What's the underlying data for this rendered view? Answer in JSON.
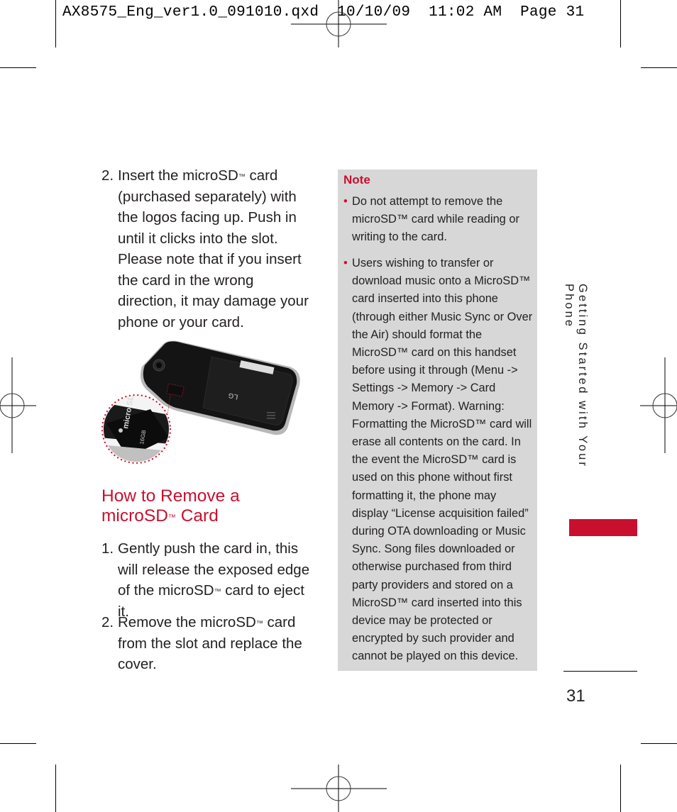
{
  "slug_line": "AX8575_Eng_ver1.0_091010.qxd  10/10/09  11:02 AM  Page 31",
  "insert_step": {
    "number": "2.",
    "text_before_tm": "Insert the microSD",
    "tm": "™",
    "text_after_tm": " card (purchased separately) with the logos facing up. Push in until it clicks into the slot. Please note that if you insert the card in the wrong direction, it may damage your phone or your card."
  },
  "figure": {
    "description": "Back of phone with microSD card inserted, magnified inset of card slot",
    "card_label": "micro SD",
    "card_capacity": "16GB",
    "brand": "LG",
    "inset_color": "#c8102e"
  },
  "section": {
    "heading_line1": "How to Remove a",
    "heading_line2_before_tm": "microSD",
    "heading_tm": "™",
    "heading_line2_after_tm": " Card"
  },
  "remove_steps": [
    {
      "number": "1.",
      "text_before_tm": "Gently push the card in, this will release the exposed edge of the microSD",
      "tm": "™",
      "text_after_tm": " card to eject it."
    },
    {
      "number": "2.",
      "text_before_tm": "Remove the microSD",
      "tm": "™",
      "text_after_tm": " card from the slot and replace the cover."
    }
  ],
  "note": {
    "title": "Note",
    "bullet": "•",
    "items": [
      "Do not attempt to remove the microSD™ card while reading or writing to the card.",
      "Users wishing to transfer or download music onto a MicroSD™ card inserted into this phone (through either Music Sync or Over the Air) should format the MicroSD™ card on this handset before using it through (Menu -> Settings -> Memory -> Card Memory -> Format). Warning: Formatting the MicroSD™ card will erase all contents on the card. In the event the MicroSD™ card is used on this phone without first formatting it, the phone may display “License acquisition failed” during OTA downloading or Music Sync. Song files downloaded or otherwise purchased from third party providers and stored on a MicroSD™ card inserted into this device may be protected or encrypted by such provider and cannot be played on this device."
    ]
  },
  "side_tab": {
    "label": "Getting Started with Your Phone",
    "color": "#c8102e"
  },
  "page_number": "31"
}
